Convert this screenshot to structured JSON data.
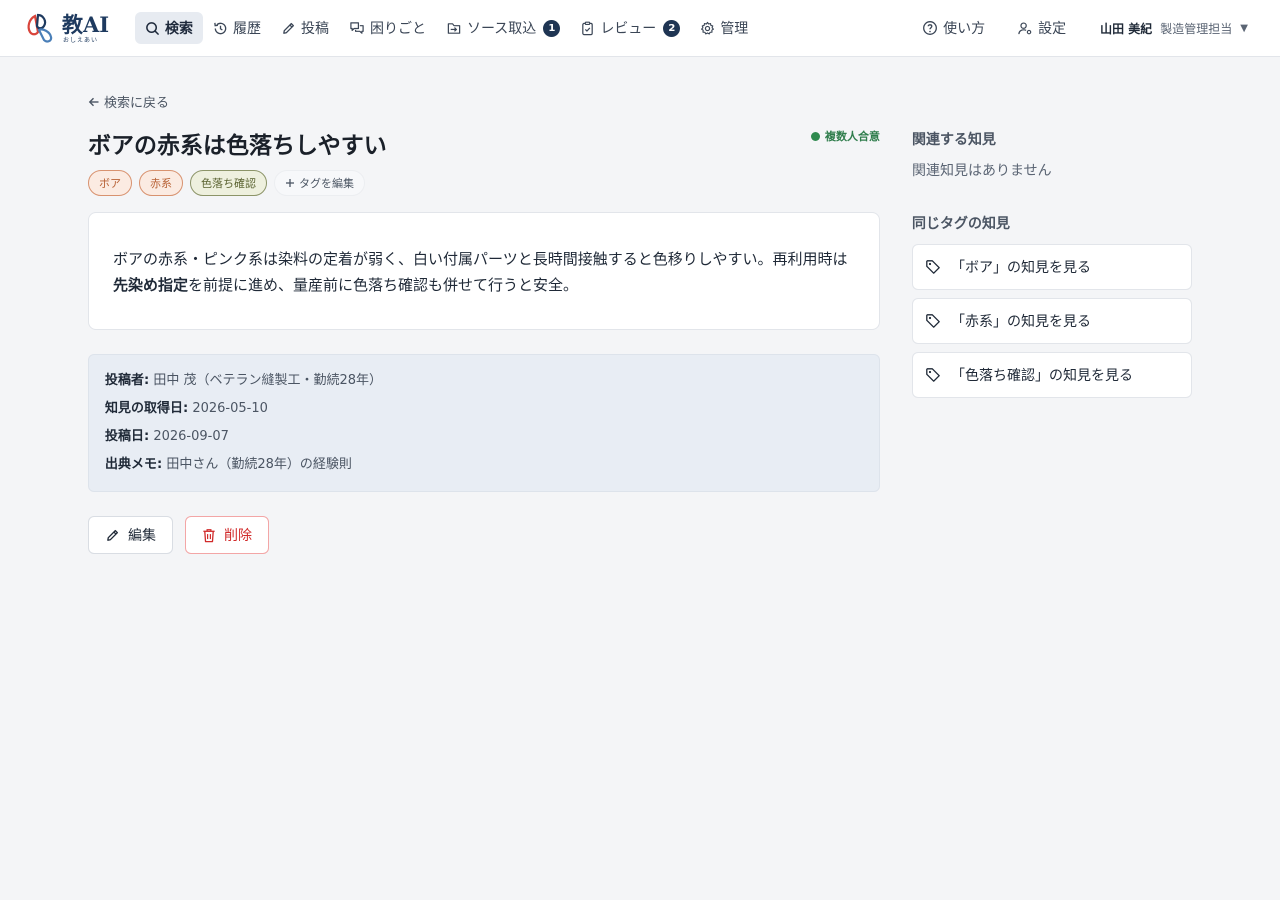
{
  "app": {
    "logo_text": "教AI",
    "logo_sub": "おしえあい"
  },
  "nav": [
    {
      "label": "検索",
      "icon": "search-icon",
      "active": true
    },
    {
      "label": "履歴",
      "icon": "history-icon"
    },
    {
      "label": "投稿",
      "icon": "pencil-icon"
    },
    {
      "label": "困りごと",
      "icon": "chat-icon"
    },
    {
      "label": "ソース取込",
      "icon": "import-icon",
      "badge": "1"
    },
    {
      "label": "レビュー",
      "icon": "clipboard-check-icon",
      "badge": "2"
    },
    {
      "label": "管理",
      "icon": "gear-icon"
    }
  ],
  "right_nav": {
    "help": "使い方",
    "settings": "設定",
    "user_name": "山田 美紀",
    "user_role": "製造管理担当",
    "caret": "▼"
  },
  "page": {
    "back": "検索に戻る",
    "title": "ボアの赤系は色落ちしやすい",
    "consensus": "複数人合意",
    "tags": [
      "ボア",
      "赤系",
      "色落ち確認"
    ],
    "tag_edit": "タグを編集",
    "body_before": "ボアの赤系・ピンク系は染料の定着が弱く、白い付属パーツと長時間接触すると色移りしやすい。再利用時は",
    "body_bold": "先染め指定",
    "body_after": "を前提に進め、量産前に色落ち確認も併せて行うと安全。",
    "meta": {
      "poster_label": "投稿者:",
      "poster_value": "田中 茂（ベテラン縫製工・勤続28年）",
      "acquired_label": "知見の取得日:",
      "acquired_value": "2026-05-10",
      "posted_label": "投稿日:",
      "posted_value": "2026-09-07",
      "source_label": "出典メモ:",
      "source_value": "田中さん（勤続28年）の経験則"
    },
    "edit_button": "編集",
    "delete_button": "削除"
  },
  "sidebar": {
    "related_heading": "関連する知見",
    "related_empty": "関連知見はありません",
    "same_tag_heading": "同じタグの知見",
    "tag_links": [
      "「ボア」の知見を見る",
      "「赤系」の知見を見る",
      "「色落ち確認」の知見を見る"
    ]
  },
  "colors": {
    "accent": "#1f3553",
    "consensus": "#2f7d4c",
    "danger": "#d12b2b"
  }
}
